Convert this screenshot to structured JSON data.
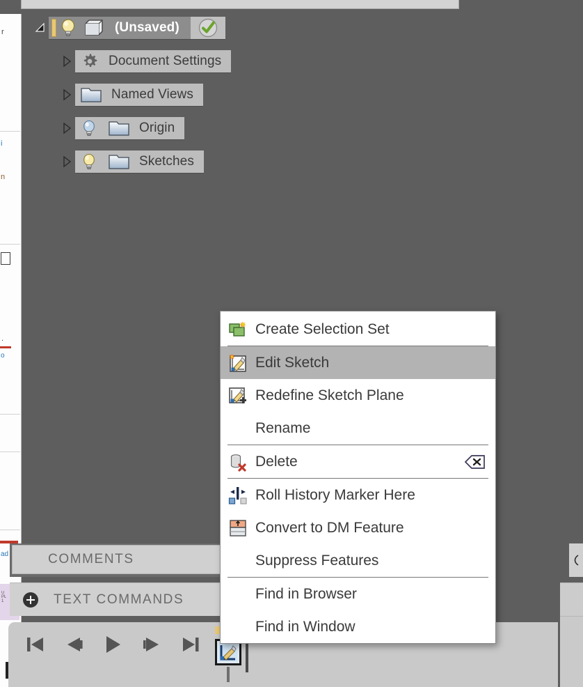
{
  "app": {
    "background_color": "#5e5e5e",
    "menu_background": "#ffffff",
    "highlight_color": "#b3b3b3",
    "tree_pill_color": "#9e9e9e"
  },
  "browser_tree": {
    "root": {
      "label": "(Unsaved)",
      "lightbulb_icon": "lightbulb-on-icon",
      "body_icon": "cube-icon",
      "status_icon": "green-check-icon",
      "disclosure_icon": "disclosure-expanded-icon"
    },
    "items": [
      {
        "label": "Document Settings",
        "icon": "gear-icon",
        "has_lightbulb": false,
        "disclosure_icon": "disclosure-collapsed-icon"
      },
      {
        "label": "Named Views",
        "icon": "folder-icon",
        "has_lightbulb": false,
        "disclosure_icon": "disclosure-collapsed-icon"
      },
      {
        "label": "Origin",
        "icon": "folder-icon",
        "has_lightbulb": true,
        "lightbulb_state": "off-blue",
        "disclosure_icon": "disclosure-collapsed-icon"
      },
      {
        "label": "Sketches",
        "icon": "folder-icon",
        "has_lightbulb": true,
        "lightbulb_state": "on-yellow",
        "disclosure_icon": "disclosure-collapsed-icon"
      }
    ]
  },
  "context_menu": {
    "groups": [
      {
        "items": [
          {
            "label": "Create Selection Set",
            "icon": "selection-set-icon",
            "highlighted": false,
            "shortcut": ""
          }
        ]
      },
      {
        "items": [
          {
            "label": "Edit Sketch",
            "icon": "edit-sketch-icon",
            "highlighted": true,
            "shortcut": ""
          },
          {
            "label": "Redefine Sketch Plane",
            "icon": "redefine-sketch-plane-icon",
            "highlighted": false,
            "shortcut": ""
          },
          {
            "label": "Rename",
            "icon": "",
            "highlighted": false,
            "shortcut": ""
          }
        ]
      },
      {
        "items": [
          {
            "label": "Delete",
            "icon": "delete-body-icon",
            "highlighted": false,
            "shortcut": "delete-key-icon"
          }
        ]
      },
      {
        "items": [
          {
            "label": "Roll History Marker Here",
            "icon": "roll-history-marker-icon",
            "highlighted": false,
            "shortcut": ""
          },
          {
            "label": "Convert to DM Feature",
            "icon": "convert-dm-feature-icon",
            "highlighted": false,
            "shortcut": ""
          },
          {
            "label": "Suppress Features",
            "icon": "",
            "highlighted": false,
            "shortcut": ""
          }
        ]
      },
      {
        "items": [
          {
            "label": "Find in Browser",
            "icon": "",
            "highlighted": false,
            "shortcut": ""
          },
          {
            "label": "Find in Window",
            "icon": "",
            "highlighted": false,
            "shortcut": ""
          }
        ]
      }
    ]
  },
  "panels": {
    "comments_label": "COMMENTS",
    "text_commands_label": "TEXT COMMANDS",
    "text_commands_toggle_icon": "plus-circle-icon",
    "right_collapse_icon": "collapse-arrow-icon"
  },
  "timeline": {
    "controls": [
      {
        "name": "go-to-beginning",
        "icon": "skip-start-icon"
      },
      {
        "name": "step-back",
        "icon": "step-back-icon"
      },
      {
        "name": "play",
        "icon": "play-icon"
      },
      {
        "name": "step-forward",
        "icon": "step-forward-icon"
      },
      {
        "name": "go-to-end",
        "icon": "skip-end-icon"
      }
    ],
    "features": [
      {
        "name": "sketch-feature",
        "icon": "sketch-feature-icon",
        "selected": true
      }
    ],
    "marker_position_label": ""
  }
}
